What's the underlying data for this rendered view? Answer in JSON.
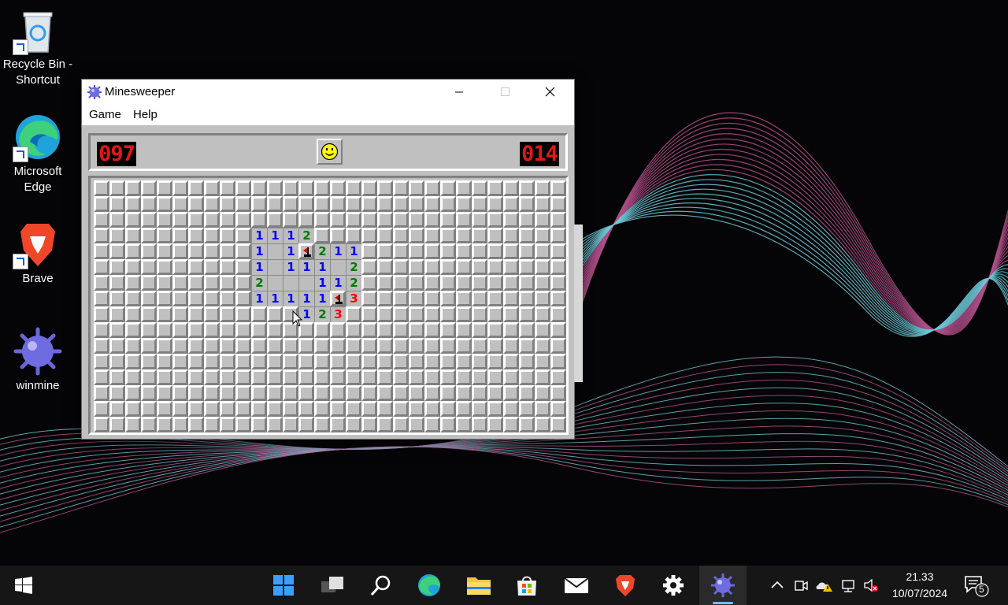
{
  "desktop": {
    "icons": [
      {
        "label": "Recycle Bin - Shortcut",
        "icon": "recycle-bin-icon"
      },
      {
        "label": "Microsoft Edge",
        "icon": "edge-icon"
      },
      {
        "label": "Brave",
        "icon": "brave-icon"
      },
      {
        "label": "winmine",
        "icon": "mine-icon"
      }
    ]
  },
  "window": {
    "title": "Minesweeper",
    "menu": [
      "Game",
      "Help"
    ],
    "mine_counter": "097",
    "timer": "014",
    "board": {
      "columns": 30,
      "rows": 16,
      "open_cells": [
        [
          3,
          10,
          "1"
        ],
        [
          3,
          11,
          "1"
        ],
        [
          3,
          12,
          "1"
        ],
        [
          3,
          13,
          "2"
        ],
        [
          4,
          10,
          "1"
        ],
        [
          4,
          11,
          ""
        ],
        [
          4,
          12,
          "1"
        ],
        [
          4,
          13,
          "F"
        ],
        [
          4,
          14,
          "2"
        ],
        [
          4,
          15,
          "1"
        ],
        [
          4,
          16,
          "1"
        ],
        [
          5,
          10,
          "1"
        ],
        [
          5,
          11,
          ""
        ],
        [
          5,
          12,
          "1"
        ],
        [
          5,
          13,
          "1"
        ],
        [
          5,
          14,
          "1"
        ],
        [
          5,
          15,
          ""
        ],
        [
          5,
          16,
          "2"
        ],
        [
          6,
          10,
          "2"
        ],
        [
          6,
          11,
          ""
        ],
        [
          6,
          12,
          ""
        ],
        [
          6,
          13,
          ""
        ],
        [
          6,
          14,
          "1"
        ],
        [
          6,
          15,
          "1"
        ],
        [
          6,
          16,
          "2"
        ],
        [
          7,
          10,
          "1"
        ],
        [
          7,
          11,
          "1"
        ],
        [
          7,
          12,
          "1"
        ],
        [
          7,
          13,
          "1"
        ],
        [
          7,
          14,
          "1"
        ],
        [
          7,
          15,
          "F"
        ],
        [
          7,
          16,
          "3"
        ],
        [
          8,
          13,
          "1"
        ],
        [
          8,
          14,
          "2"
        ],
        [
          8,
          15,
          "3"
        ]
      ]
    }
  },
  "number_colors": {
    "1": "#0000ff",
    "2": "#007b00",
    "3": "#ff0000"
  },
  "taskbar": {
    "apps": [
      "start-icon",
      "widgets-icon",
      "task-view-icon",
      "search-icon",
      "edge-icon",
      "file-explorer-icon",
      "store-icon",
      "mail-icon",
      "brave-icon",
      "settings-icon",
      "minesweeper-icon"
    ],
    "active_app": "minesweeper-icon",
    "clock_time": "21.33",
    "clock_date": "10/07/2024",
    "notification_count": "5"
  }
}
